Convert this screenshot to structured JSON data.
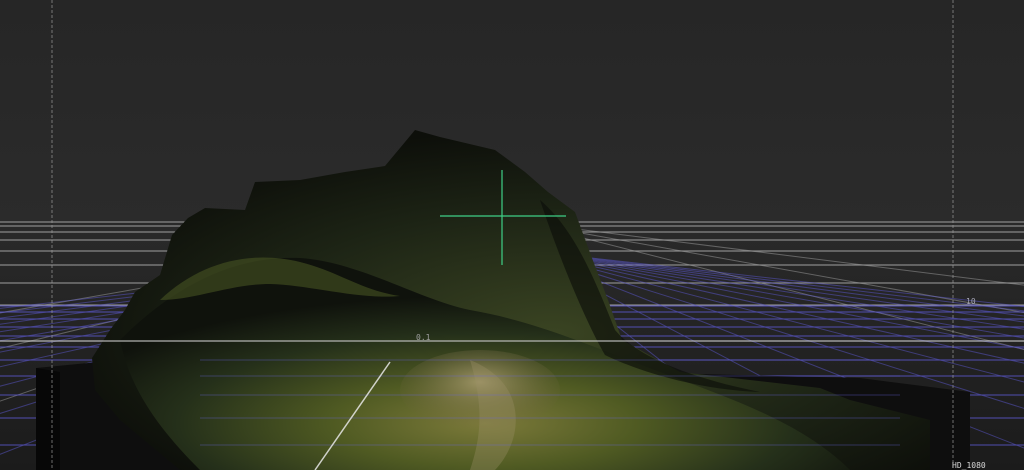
{
  "viewport": {
    "background": "#262626",
    "grid_color": "#c8c8c8",
    "grid_plane_color": "#5e5ad6",
    "crosshair_color": "#3fcf86",
    "guide_color": "#9a9a9a"
  },
  "labels": {
    "origin_tick": "0.1",
    "far_tick": "10",
    "resolution": "HD_1080"
  }
}
